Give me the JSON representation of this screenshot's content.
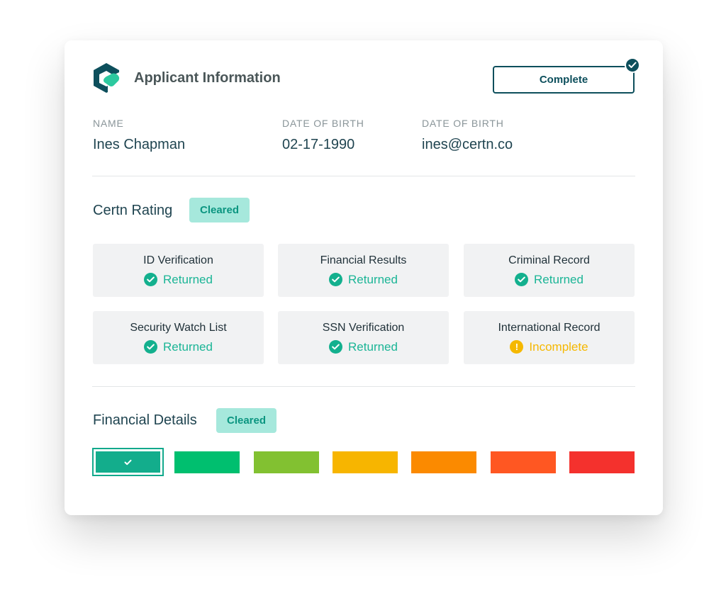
{
  "header": {
    "title": "Applicant Information",
    "complete_label": "Complete"
  },
  "applicant": {
    "fields": [
      {
        "label": "NAME",
        "value": "Ines Chapman"
      },
      {
        "label": "DATE OF BIRTH",
        "value": "02-17-1990"
      },
      {
        "label": "DATE OF BIRTH",
        "value": "ines@certn.co"
      }
    ]
  },
  "rating": {
    "title": "Certn Rating",
    "badge": "Cleared"
  },
  "checks": [
    {
      "label": "ID Verification",
      "status": "Returned",
      "state": "ok"
    },
    {
      "label": "Financial Results",
      "status": "Returned",
      "state": "ok"
    },
    {
      "label": "Criminal Record",
      "status": "Returned",
      "state": "ok"
    },
    {
      "label": "Security Watch List",
      "status": "Returned",
      "state": "ok"
    },
    {
      "label": "SSN Verification",
      "status": "Returned",
      "state": "ok"
    },
    {
      "label": "International Record",
      "status": "Incomplete",
      "state": "warn"
    }
  ],
  "financial": {
    "title": "Financial Details",
    "badge": "Cleared",
    "selected_index": 0,
    "scale_colors": [
      "#13ad8c",
      "#00bf6f",
      "#82c131",
      "#f7b500",
      "#fb8a00",
      "#ff5722",
      "#f4312d"
    ]
  },
  "colors": {
    "brand_dark": "#0d4f5c",
    "accent": "#13b08e",
    "warning": "#f5b800"
  }
}
